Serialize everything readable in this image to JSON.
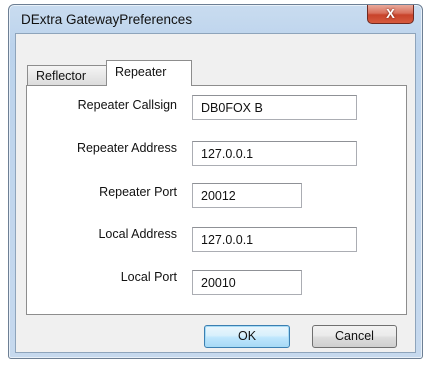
{
  "window": {
    "title": "DExtra GatewayPreferences",
    "close_glyph": "X"
  },
  "tabs": [
    {
      "label": "Reflector",
      "selected": false
    },
    {
      "label": "Repeater",
      "selected": true
    }
  ],
  "form": {
    "repeater_callsign": {
      "label": "Repeater Callsign",
      "value": "DB0FOX B"
    },
    "repeater_address": {
      "label": "Repeater Address",
      "value": "127.0.0.1"
    },
    "repeater_port": {
      "label": "Repeater Port",
      "value": "20012"
    },
    "local_address": {
      "label": "Local Address",
      "value": "127.0.0.1"
    },
    "local_port": {
      "label": "Local Port",
      "value": "20010"
    }
  },
  "buttons": {
    "ok": "OK",
    "cancel": "Cancel"
  },
  "colors": {
    "titlebar": "#bcd3ec",
    "close_button": "#c8432b",
    "default_button_border": "#3c7fb1"
  }
}
